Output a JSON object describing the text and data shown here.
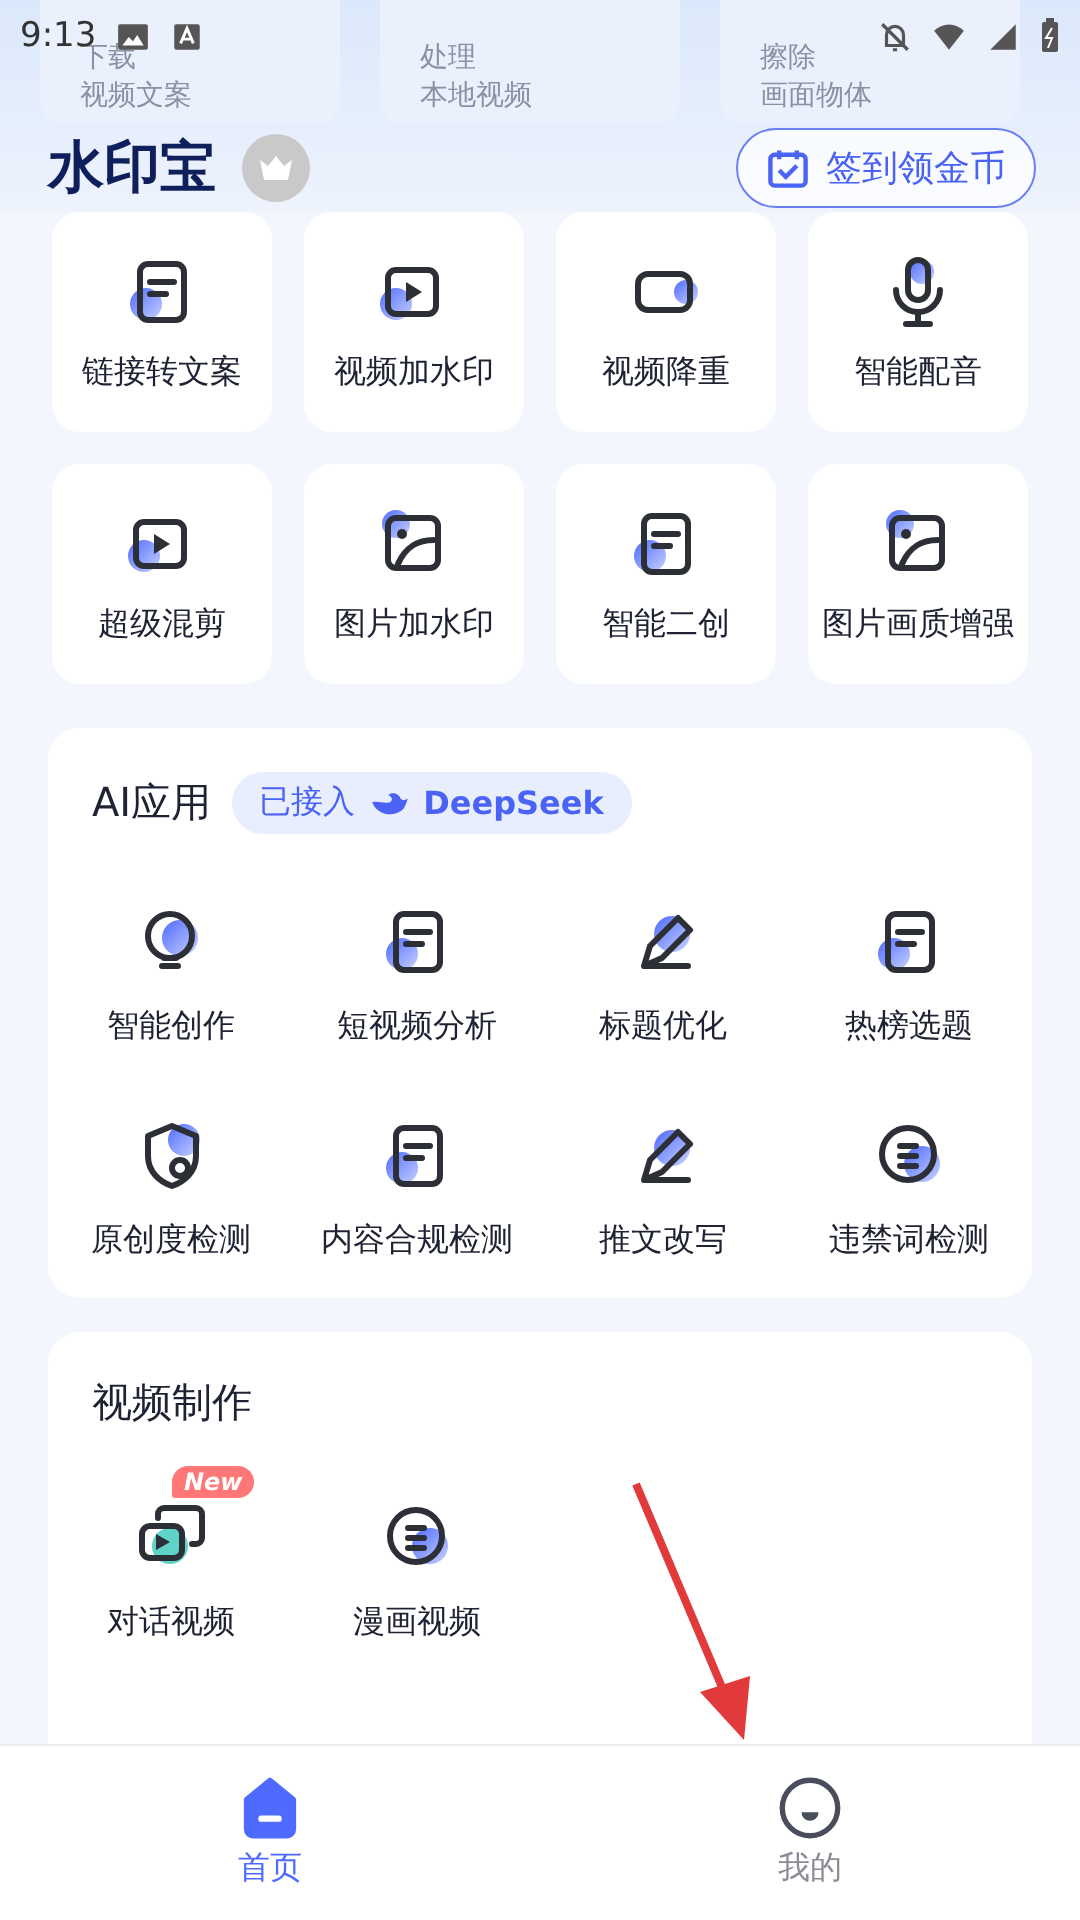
{
  "status_bar": {
    "time": "9:13"
  },
  "background_cards": [
    {
      "line_1": "下载",
      "line_2": "视频文案"
    },
    {
      "line_1": "处理",
      "line_2": "本地视频"
    },
    {
      "line_1": "擦除",
      "line_2": "画面物体"
    }
  ],
  "header": {
    "logo": "水印宝",
    "checkin_button": "签到领金币"
  },
  "tools": [
    "链接转文案",
    "视频加水印",
    "视频降重",
    "智能配音",
    "超级混剪",
    "图片加水印",
    "智能二创",
    "图片画质增强"
  ],
  "ai_section": {
    "title": "AI应用",
    "badge_prefix": "已接入",
    "badge_brand": "DeepSeek",
    "items": [
      "智能创作",
      "短视频分析",
      "标题优化",
      "热榜选题",
      "原创度检测",
      "内容合规检测",
      "推文改写",
      "违禁词检测"
    ]
  },
  "video_section": {
    "title": "视频制作",
    "items": [
      {
        "label": "对话视频",
        "badge": "New"
      },
      {
        "label": "漫画视频"
      }
    ]
  },
  "bottom_nav": [
    {
      "label": "首页",
      "selected": true
    },
    {
      "label": "我的",
      "selected": false
    }
  ]
}
